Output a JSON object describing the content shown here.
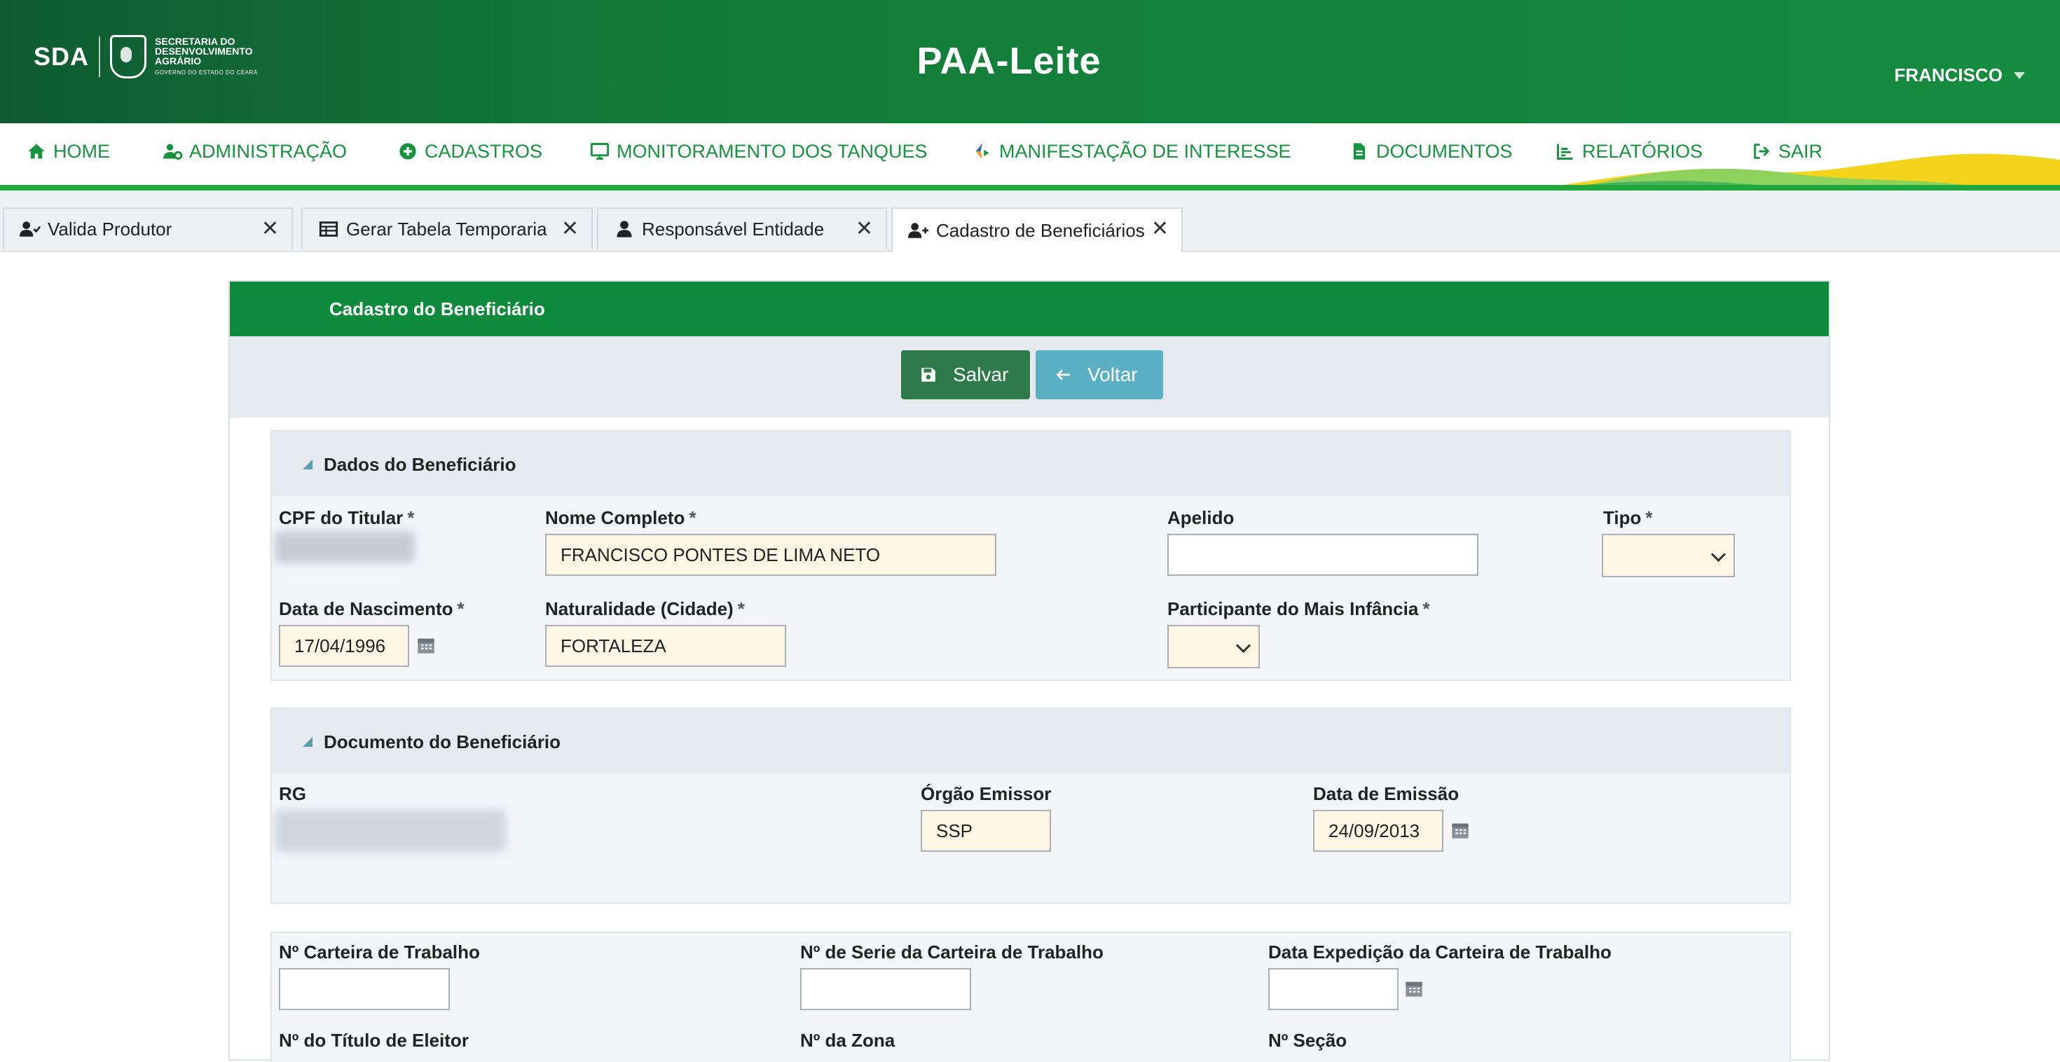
{
  "header": {
    "logo_text": "SDA",
    "logo_subtitle": [
      "SECRETARIA DO",
      "DESENVOLVIMENTO",
      "AGRÁRIO"
    ],
    "logo_gov": "GOVERNO DO ESTADO DO CEARÁ",
    "app_title": "PAA-Leite",
    "user_name": "FRANCISCO"
  },
  "nav": {
    "items": [
      {
        "label": "HOME",
        "icon": "home-icon"
      },
      {
        "label": "ADMINISTRAÇÃO",
        "icon": "user-gear-icon"
      },
      {
        "label": "CADASTROS",
        "icon": "plus-circle-icon"
      },
      {
        "label": "MONITORAMENTO DOS TANQUES",
        "icon": "monitor-icon"
      },
      {
        "label": "MANIFESTAÇÃO DE INTERESSE",
        "icon": "diamond-logo-icon"
      },
      {
        "label": "DOCUMENTOS",
        "icon": "file-icon"
      },
      {
        "label": "RELATÓRIOS",
        "icon": "bar-chart-icon"
      },
      {
        "label": "SAIR",
        "icon": "sign-out-icon"
      }
    ],
    "accent": "#17933f"
  },
  "tabs": [
    {
      "label": "Valida Produtor",
      "icon": "user-check-icon",
      "active": false
    },
    {
      "label": "Gerar Tabela Temporaria",
      "icon": "table-icon",
      "active": false
    },
    {
      "label": "Responsável Entidade",
      "icon": "user-icon",
      "active": false
    },
    {
      "label": "Cadastro de Beneficiários",
      "icon": "user-plus-icon",
      "active": true
    }
  ],
  "form": {
    "title": "Cadastro do Beneficiário",
    "save_label": "Salvar",
    "back_label": "Voltar",
    "required_mark": "*",
    "dados": {
      "title": "Dados do Beneficiário",
      "cpf_label": "CPF do Titular",
      "nome_label": "Nome Completo",
      "nome_value": "FRANCISCO PONTES DE LIMA NETO",
      "apelido_label": "Apelido",
      "apelido_value": "",
      "tipo_label": "Tipo",
      "tipo_value": "",
      "nascimento_label": "Data de Nascimento",
      "nascimento_value": "17/04/1996",
      "naturalidade_label": "Naturalidade (Cidade)",
      "naturalidade_value": "FORTALEZA",
      "mais_infancia_label": "Participante do Mais Infância",
      "mais_infancia_value": ""
    },
    "documento": {
      "title": "Documento do Beneficiário",
      "rg_label": "RG",
      "orgao_label": "Órgão Emissor",
      "orgao_value": "SSP",
      "emissao_label": "Data de Emissão",
      "emissao_value": "24/09/2013"
    },
    "trabalho": {
      "carteira_label": "Nº Carteira de Trabalho",
      "carteira_value": "",
      "serie_label": "Nº de Serie da Carteira de Trabalho",
      "serie_value": "",
      "expedicao_label": "Data Expedição da Carteira de Trabalho",
      "expedicao_value": "",
      "titulo_label": "Nº do Título de Eleitor",
      "zona_label": "Nº da Zona",
      "secao_label": "Nº Seção"
    }
  },
  "colors": {
    "header_green": "#137a3a",
    "panel_head": "#0d8a3c",
    "save_button": "#2f7a4b",
    "back_button": "#5bb0c4",
    "required_input_bg": "#fff7e6"
  }
}
